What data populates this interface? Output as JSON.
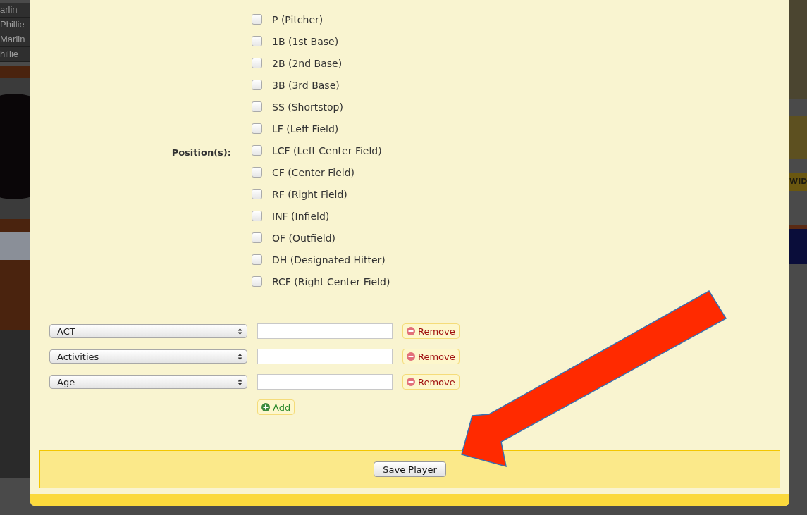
{
  "background": {
    "side_links": [
      "arlin",
      "Phillie",
      "Marlin",
      "hillie"
    ],
    "banner_text": "WID"
  },
  "form": {
    "positions_label": "Position(s):",
    "positions": [
      {
        "label": "P (Pitcher)",
        "checked": false
      },
      {
        "label": "1B (1st Base)",
        "checked": false
      },
      {
        "label": "2B (2nd Base)",
        "checked": false
      },
      {
        "label": "3B (3rd Base)",
        "checked": false
      },
      {
        "label": "SS (Shortstop)",
        "checked": false
      },
      {
        "label": "LF (Left Field)",
        "checked": false
      },
      {
        "label": "LCF (Left Center Field)",
        "checked": false
      },
      {
        "label": "CF (Center Field)",
        "checked": false
      },
      {
        "label": "RF (Right Field)",
        "checked": false
      },
      {
        "label": "INF (Infield)",
        "checked": false
      },
      {
        "label": "OF (Outfield)",
        "checked": false
      },
      {
        "label": "DH (Designated Hitter)",
        "checked": false
      },
      {
        "label": "RCF (Right Center Field)",
        "checked": false
      }
    ],
    "attributes": [
      {
        "select": "ACT",
        "remove": "Remove"
      },
      {
        "select": "Activities",
        "remove": "Remove"
      },
      {
        "select": "Age",
        "remove": "Remove"
      }
    ],
    "add": "Add",
    "save": "Save Player"
  }
}
